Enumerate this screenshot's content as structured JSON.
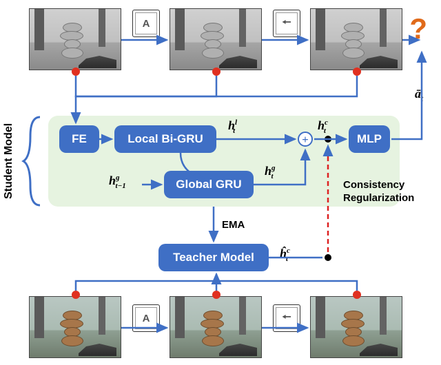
{
  "key_labels": {
    "a": "A",
    "b": "🠔"
  },
  "qmark": "?",
  "blocks": {
    "fe": "FE",
    "local": "Local Bi-GRU",
    "global": "Global GRU",
    "mlp": "MLP",
    "teacher": "Teacher Model"
  },
  "symbols": {
    "h_local": "h<span style='font-style:italic'><sup>l</sup><sub style='margin-left:-6px'>t</sub></span>",
    "h_global": "h<span style='font-style:italic'><sup>g</sup><sub style='margin-left:-6px'>t</sub></span>",
    "h_global_prev": "h<span style='font-style:italic'><sup>g</sup><sub style='margin-left:-6px'>t−1</sub></span>",
    "h_concat": "h<span style='font-style:italic'><sup>c</sup><sub style='margin-left:-6px'>t</sub></span>",
    "h_concat_hat": "<span style='position:relative'>ĥ</span><span style='font-style:italic'><sup>c</sup><sub style='margin-left:-6px'>t</sub></span>",
    "a_bar": "ā<sub>t</sub>"
  },
  "captions": {
    "student": "Student Model",
    "ema": "EMA",
    "consistency1": "Consistency",
    "consistency2": "Regularization"
  },
  "chart_data": {
    "type": "diagram",
    "description": "Teacher-student architecture with consistency regularization",
    "top_inputs": {
      "frames": 3,
      "style": "greyscale game frames",
      "interleaved_keys": [
        "A",
        "left-arrow"
      ],
      "output_symbol": "?"
    },
    "student_model": {
      "blocks": [
        "FE",
        "Local Bi-GRU",
        "Global GRU",
        "concat(+)",
        "MLP"
      ],
      "edges": [
        [
          "frames",
          "FE"
        ],
        [
          "FE",
          "Local Bi-GRU"
        ],
        [
          "Local Bi-GRU",
          "concat",
          "h^l_t"
        ],
        [
          "Local Bi-GRU",
          "Global GRU"
        ],
        [
          "h^g_{t-1}",
          "Global GRU"
        ],
        [
          "Global GRU",
          "concat",
          "h^g_t"
        ],
        [
          "concat",
          "MLP",
          "h^c_t"
        ],
        [
          "MLP",
          "ā_t"
        ]
      ]
    },
    "teacher_model": {
      "input_frames": 3,
      "style": "color game frames",
      "interleaved_keys": [
        "A",
        "left-arrow"
      ],
      "output": "ĥ^c_t"
    },
    "couplings": [
      {
        "from": "Student Model",
        "to": "Teacher Model",
        "label": "EMA",
        "direction": "down"
      },
      {
        "between": [
          "h^c_t",
          "ĥ^c_t"
        ],
        "label": "Consistency Regularization",
        "style": "dashed red"
      }
    ]
  }
}
